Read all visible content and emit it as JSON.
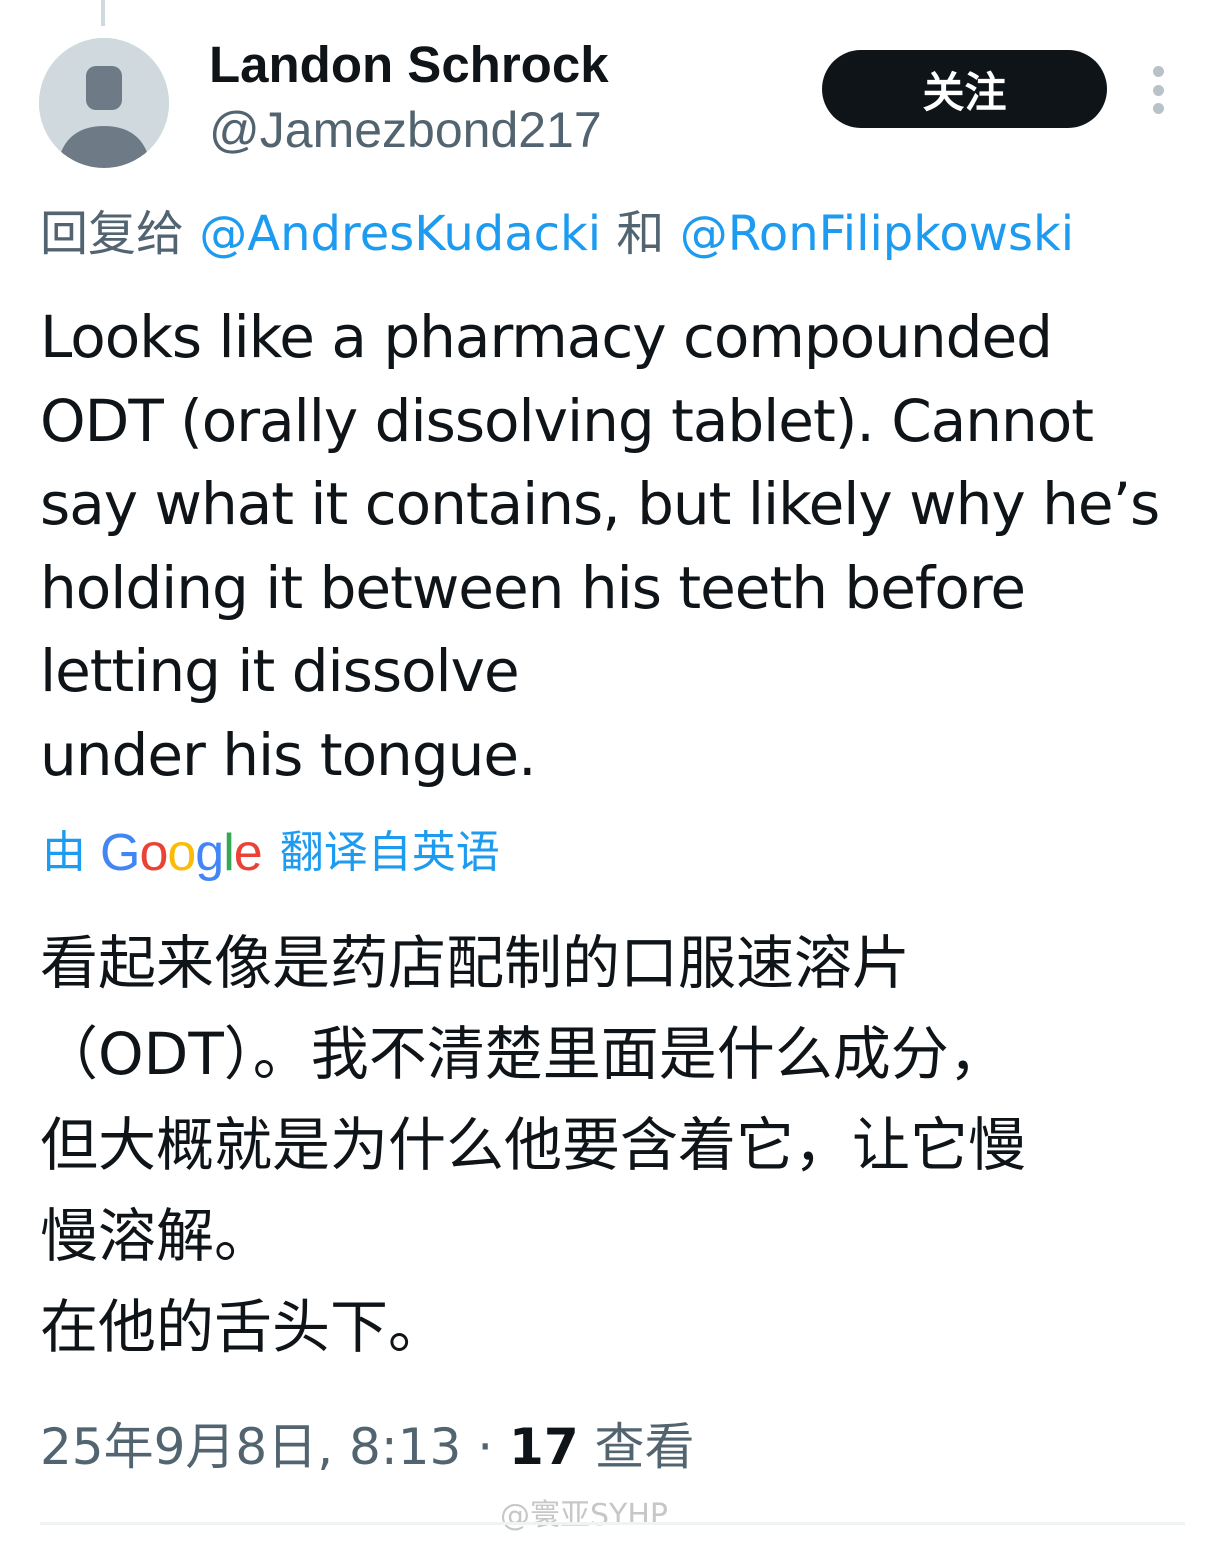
{
  "author": {
    "display_name": "Landon Schrock",
    "handle": "@Jamezbond217",
    "avatar_icon": "default-person-icon"
  },
  "follow_label": "关注",
  "more_icon": "vertical-ellipsis-icon",
  "reply_to": {
    "prefix": "回复给",
    "mention_1": "@AndresKudacki",
    "joiner": "和",
    "mention_2": "@RonFilipkowski"
  },
  "tweet_lines": [
    "Looks like a pharmacy compounded",
    "ODT (orally dissolving tablet). Cannot",
    "say what it contains, but likely why he’s",
    "holding it between his teeth before",
    "letting it dissolve",
    "under his tongue."
  ],
  "translation_credit": {
    "prefix": "由",
    "google": [
      "G",
      "o",
      "o",
      "g",
      "l",
      "e"
    ],
    "suffix": "翻译自英语"
  },
  "translation_lines": [
    "看起来像是药店配制的口服速溶片",
    "（ODT）。我不清楚里面是什么成分，",
    "但大概就是为什么他要含着它，让它慢",
    "慢溶解。",
    "在他的舌头下。"
  ],
  "meta": {
    "date_time": "25年9月8日, 8:13",
    "separator": "·",
    "views_count": "17",
    "views_label": "查看"
  },
  "watermark": "@寰亚SYHP",
  "colors": {
    "accent": "#1d9bf0",
    "secondary_text": "#536471",
    "google_blue": "#4285F4",
    "google_red": "#EA4335",
    "google_yellow": "#FBBC05",
    "google_green": "#34A853"
  }
}
